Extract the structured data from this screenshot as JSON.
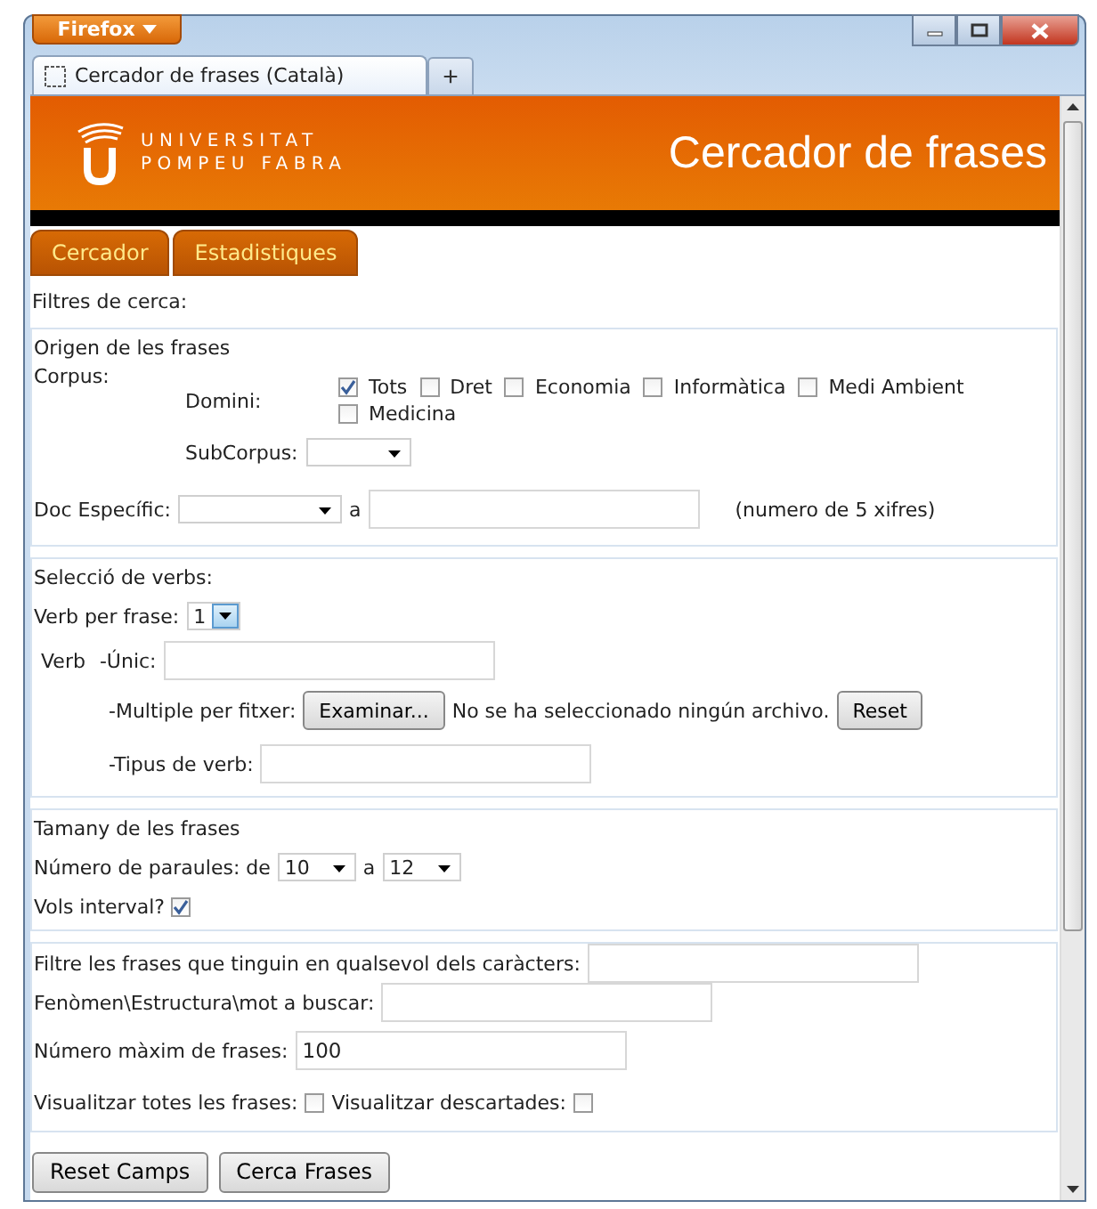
{
  "browser": {
    "menu_label": "Firefox",
    "tab_title": "Cercador de frases (Català)",
    "new_tab": "+"
  },
  "header": {
    "logo_lines": [
      "UNIVERSITAT",
      "POMPEU FABRA"
    ],
    "title": "Cercador de frases"
  },
  "tabs": [
    {
      "label": "Cercador"
    },
    {
      "label": "Estadistiques"
    }
  ],
  "filters_title": "Filtres de cerca:",
  "origin": {
    "title": "Origen de les frases",
    "corpus_label": "Corpus:",
    "domain_label": "Domini:",
    "domains": [
      {
        "label": "Tots",
        "checked": true
      },
      {
        "label": "Dret",
        "checked": false
      },
      {
        "label": "Economia",
        "checked": false
      },
      {
        "label": "Informàtica",
        "checked": false
      },
      {
        "label": "Medi Ambient",
        "checked": false
      },
      {
        "label": "Medicina",
        "checked": false
      }
    ],
    "subcorpus_label": "SubCorpus:",
    "doc_label": "Doc Específic:",
    "doc_to": "a",
    "doc_hint": "(numero de 5 xifres)"
  },
  "verbs": {
    "title": "Selecció de verbs:",
    "per_phrase_label": "Verb per frase:",
    "per_phrase_value": "1",
    "verb_label": "Verb",
    "unique_label": "-Únic:",
    "multiple_label": "-Multiple per fitxer:",
    "browse_button": "Examinar...",
    "file_status": "No se ha seleccionado ningún archivo.",
    "reset_button": "Reset",
    "type_label": "-Tipus de verb:"
  },
  "size": {
    "title": "Tamany de les frases",
    "words_label": "Número de paraules: de",
    "from_value": "10",
    "to_label": "a",
    "to_value": "12",
    "interval_label": "Vols interval?",
    "interval_checked": true
  },
  "extra": {
    "chars_label": "Filtre les frases que tinguin en qualsevol dels caràcters:",
    "search_label": "Fenòmen\\Estructura\\mot a buscar:",
    "max_label": "Número màxim de frases:",
    "max_value": "100",
    "show_all_label": "Visualitzar totes les frases:",
    "show_all_checked": false,
    "show_discarded_label": "Visualitzar descartades:",
    "show_discarded_checked": false
  },
  "buttons": [
    "Reset Camps",
    "Cerca Frases"
  ]
}
